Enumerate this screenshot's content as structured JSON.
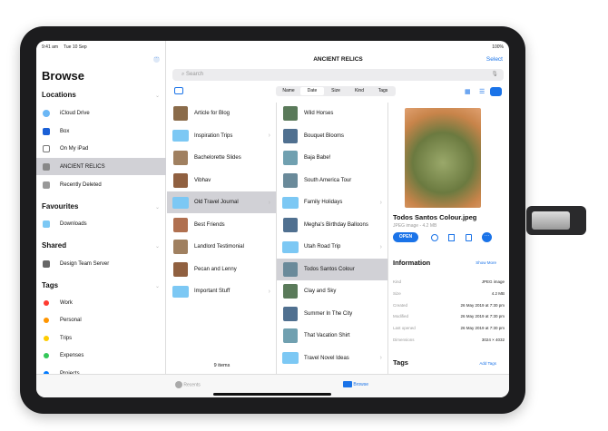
{
  "status": {
    "time": "9:41 am",
    "date": "Tue 10 Sep",
    "battery": "100%"
  },
  "sidebar": {
    "title": "Browse",
    "locations": {
      "header": "Locations",
      "items": [
        {
          "label": "iCloud Drive"
        },
        {
          "label": "Box"
        },
        {
          "label": "On My iPad"
        },
        {
          "label": "ANCIENT RELICS"
        },
        {
          "label": "Recently Deleted"
        }
      ]
    },
    "favourites": {
      "header": "Favourites",
      "items": [
        {
          "label": "Downloads"
        }
      ]
    },
    "shared": {
      "header": "Shared",
      "items": [
        {
          "label": "Design Team Server"
        }
      ]
    },
    "tags": {
      "header": "Tags",
      "items": [
        {
          "label": "Work",
          "color": "#ff3b30"
        },
        {
          "label": "Personal",
          "color": "#ff9500"
        },
        {
          "label": "Trips",
          "color": "#ffcc00"
        },
        {
          "label": "Expenses",
          "color": "#34c759"
        },
        {
          "label": "Projects",
          "color": "#007aff"
        }
      ]
    }
  },
  "main": {
    "title": "ANCIENT RELICS",
    "select": "Select",
    "search_placeholder": "Search",
    "sort": [
      "Name",
      "Date",
      "Size",
      "Kind",
      "Tags"
    ],
    "col1": {
      "items": [
        "Article for Blog",
        "Inspiration Trips",
        "Bachelorette Slides",
        "Vibhav",
        "Old Travel Journal",
        "Best Friends",
        "Landlord Testimonial",
        "Pecan and Lenny",
        "Important Stuff"
      ],
      "count": "9 items"
    },
    "col2": {
      "items": [
        "Wild Horses",
        "Bouquet Blooms",
        "Baja Babe!",
        "South America Tour",
        "Family Holidays",
        "Megha's Birthday Balloons",
        "Utah Road Trip",
        "Todos Santos Colour",
        "Clay and Sky",
        "Summer In The City",
        "That Vacation Shirt",
        "Travel Novel Ideas"
      ]
    },
    "preview": {
      "name": "Todos Santos Colour.jpeg",
      "meta": "JPEG image - 4.2 MB",
      "open": "OPEN",
      "info_header": "Information",
      "show_more": "Show More",
      "rows": [
        {
          "k": "Kind",
          "v": "JPEG image"
        },
        {
          "k": "Size",
          "v": "4.2 MB"
        },
        {
          "k": "Created",
          "v": "26 May 2019 at 7:30 pm"
        },
        {
          "k": "Modified",
          "v": "26 May 2019 at 7:30 pm"
        },
        {
          "k": "Last opened",
          "v": "26 May 2019 at 7:30 pm"
        },
        {
          "k": "Dimensions",
          "v": "3024 × 4032"
        }
      ],
      "tags_header": "Tags",
      "add_tags": "Add Tags"
    }
  },
  "tabbar": {
    "recents": "Recents",
    "browse": "Browse"
  }
}
